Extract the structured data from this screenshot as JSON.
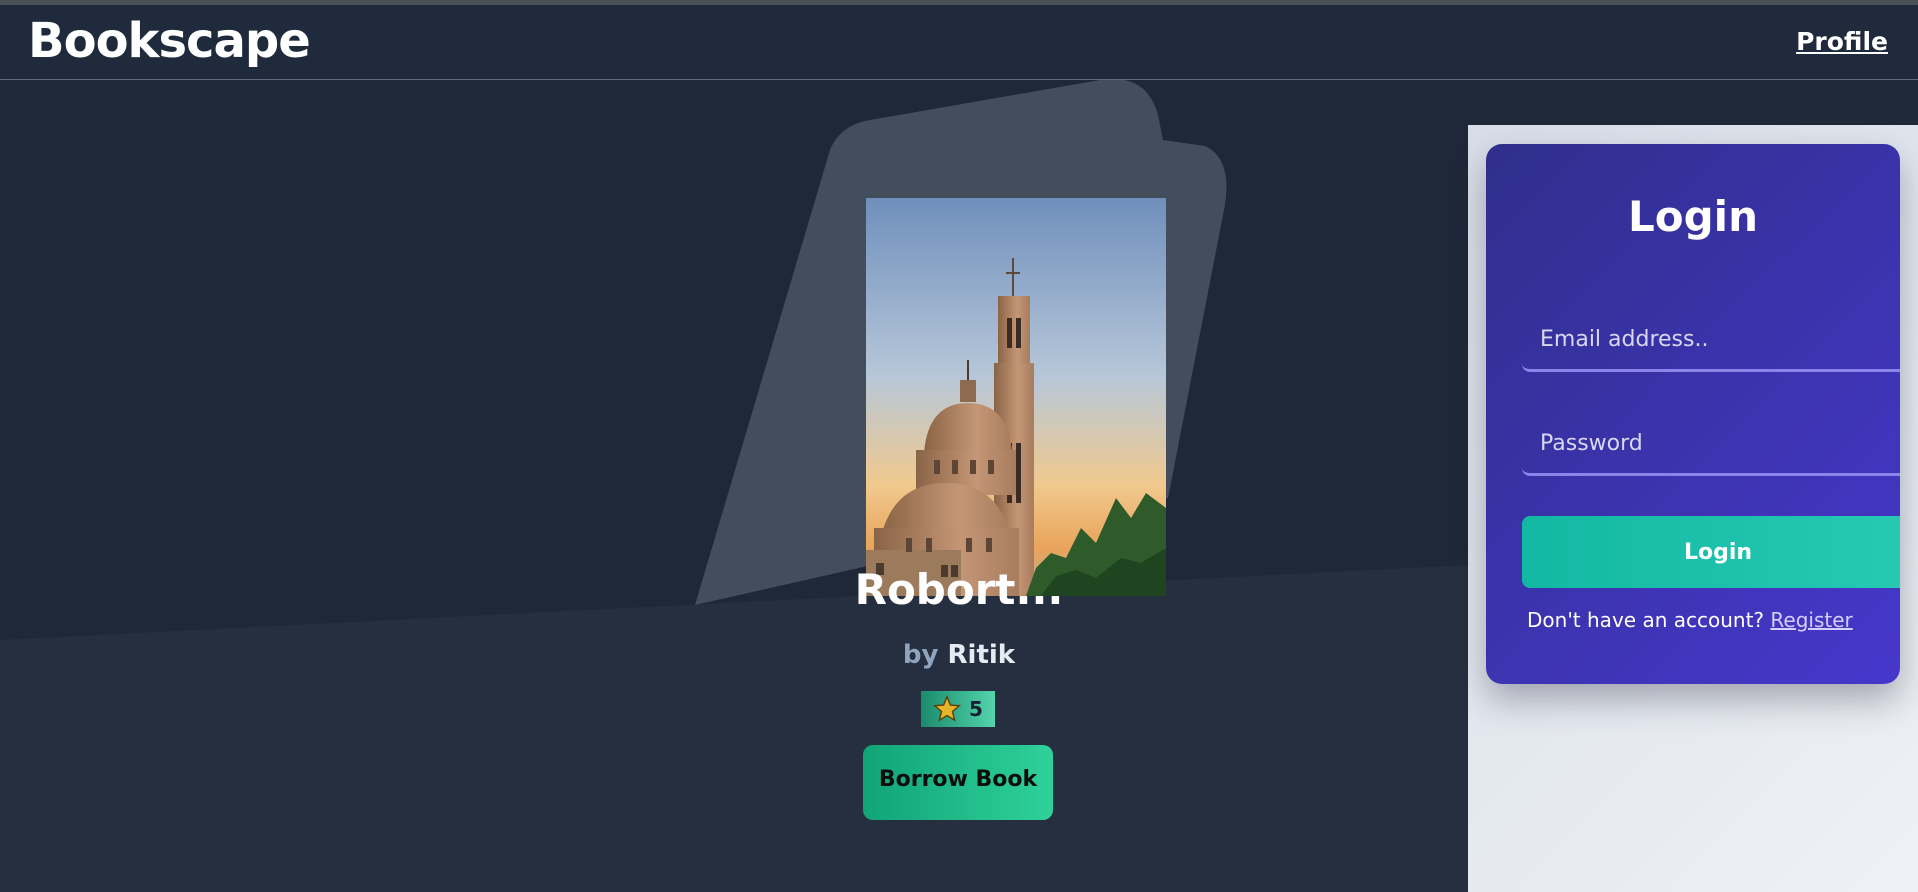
{
  "navbar": {
    "brand": "Bookscape",
    "profile_label": "Profile"
  },
  "book": {
    "title": "Robort...",
    "by_label": "by",
    "author": "Ritik",
    "rating": "5",
    "borrow_label": "Borrow Book"
  },
  "login": {
    "title": "Login",
    "email_placeholder": "Email address..",
    "password_placeholder": "Password",
    "button_label": "Login",
    "register_prompt": "Don't have an account?",
    "register_link": "Register"
  },
  "colors": {
    "page_bg": "#1f2838",
    "navbar_bg": "#1f2a3c",
    "card_gradient_start": "#2f2f8c",
    "card_gradient_end": "#4637cc",
    "login_button": "#1cbfa9",
    "borrow_button": "#1ab985",
    "rating_badge": "#3fc79c"
  },
  "icons": {
    "rating": "star-icon"
  }
}
